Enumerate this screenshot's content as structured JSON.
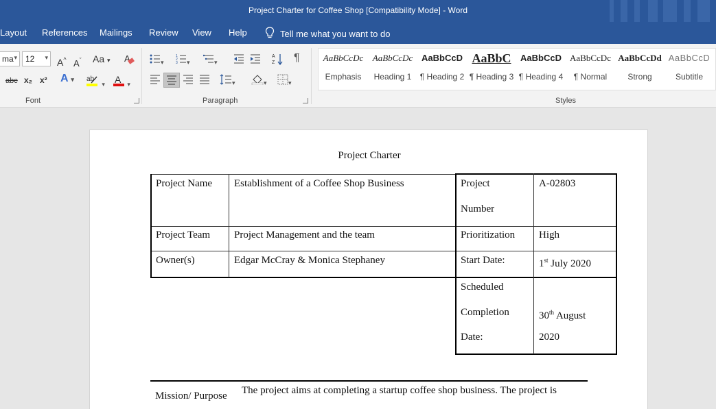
{
  "window": {
    "title": "Project Charter for Coffee Shop [Compatibility Mode]  -  Word"
  },
  "menu": {
    "tabs": [
      "Layout",
      "References",
      "Mailings",
      "Review",
      "View",
      "Help"
    ],
    "tell_me": "Tell me what you want to do"
  },
  "ribbon": {
    "font": {
      "name_value": "ma",
      "size_value": "12",
      "grow_label": "A",
      "shrink_label": "A",
      "case_label": "Aa",
      "strike_label": "abc",
      "subscript_label": "x₂",
      "superscript_label": "x²",
      "group_label": "Font",
      "highlight_color": "#ffff00",
      "font_color": "#e01010"
    },
    "paragraph": {
      "group_label": "Paragraph",
      "pilcrow": "¶"
    },
    "styles": {
      "group_label": "Styles",
      "items": [
        {
          "sample": "AaBbCcDc",
          "name": "Emphasis"
        },
        {
          "sample": "AaBbCcDc",
          "name": "Heading 1"
        },
        {
          "sample": "AaBbCcD",
          "name": "¶ Heading 2"
        },
        {
          "sample": "AaBbC",
          "name": "¶ Heading 3"
        },
        {
          "sample": "AaBbCcD",
          "name": "¶ Heading 4"
        },
        {
          "sample": "AaBbCcDc",
          "name": "¶ Normal"
        },
        {
          "sample": "AaBbCcDd",
          "name": "Strong"
        },
        {
          "sample": "AaBbCcD",
          "name": "Subtitle"
        }
      ]
    }
  },
  "document": {
    "title": "Project Charter",
    "table": {
      "project_name_label": "Project Name",
      "project_name_value": "Establishment of a Coffee Shop Business",
      "project_number_label_1": "Project",
      "project_number_label_2": "Number",
      "project_number_value": "A-02803",
      "project_team_label": "Project Team",
      "project_team_value": "Project Management and the team",
      "prioritization_label": "Prioritization",
      "prioritization_value": "High",
      "owners_label": "Owner(s)",
      "owners_value": "Edgar McCray & Monica Stephaney",
      "start_date_label": "Start Date:",
      "start_day": "1",
      "start_suffix": "st",
      "start_rest": " July 2020",
      "completion_label_1": "Scheduled",
      "completion_label_2": "Completion",
      "completion_label_3": "Date:",
      "completion_day": "30",
      "completion_suffix": "th",
      "completion_rest": " August",
      "completion_year": "2020"
    },
    "mission_label": "Mission/ Purpose",
    "mission_text": "The project aims at completing a startup coffee shop business. The project is"
  }
}
